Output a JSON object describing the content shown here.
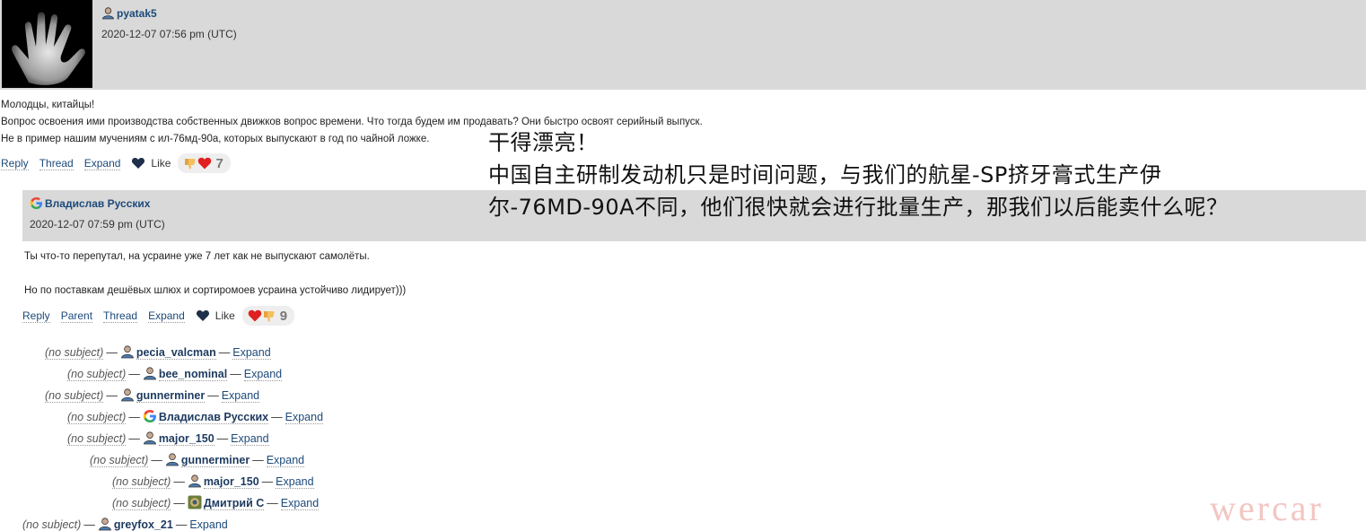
{
  "comment1": {
    "username": "pyatak5",
    "date": "2020-12-07 07:56 pm (UTC)",
    "body": [
      "Молодцы, китайцы!",
      "Вопрос освоения ими производства собственных движков вопрос времени. Что тогда будем им продавать? Они быстро освоят серийный выпуск.",
      "Не в пример нашим мучениям с ил-76мд-90а, которых выпускают в год по чайной ложке."
    ],
    "actions": {
      "reply": "Reply",
      "thread": "Thread",
      "expand": "Expand",
      "like": "Like",
      "reaction_count": "7"
    }
  },
  "comment2": {
    "username": "Владислав Русских",
    "date": "2020-12-07 07:59 pm (UTC)",
    "body": [
      "Ты что-то перепутал, на усраине уже 7 лет как не выпускают самолёты.",
      "Но по поставкам дешёвых шлюх и сортиромоев усраина устойчиво лидирует)))"
    ],
    "actions": {
      "reply": "Reply",
      "parent": "Parent",
      "thread": "Thread",
      "expand": "Expand",
      "like": "Like",
      "reaction_count": "9"
    }
  },
  "thread": [
    {
      "subject": "(no subject)",
      "author": "pecia_valcman",
      "expand": "Expand",
      "icon": "user-icon"
    },
    {
      "subject": "(no subject)",
      "author": "bee_nominal",
      "expand": "Expand",
      "icon": "user-icon"
    },
    {
      "subject": "(no subject)",
      "author": "gunnerminer",
      "expand": "Expand",
      "icon": "user-icon"
    },
    {
      "subject": "(no subject)",
      "author": "Владислав Русских",
      "expand": "Expand",
      "icon": "google-icon"
    },
    {
      "subject": "(no subject)",
      "author": "major_150",
      "expand": "Expand",
      "icon": "user-icon"
    },
    {
      "subject": "(no subject)",
      "author": "gunnerminer",
      "expand": "Expand",
      "icon": "user-icon"
    },
    {
      "subject": "(no subject)",
      "author": "major_150",
      "expand": "Expand",
      "icon": "user-icon"
    },
    {
      "subject": "(no subject)",
      "author": "Дмитрий С",
      "expand": "Expand",
      "icon": "photo-avatar-icon"
    },
    {
      "subject": "(no subject)",
      "author": "greyfox_21",
      "expand": "Expand",
      "icon": "user-icon"
    }
  ],
  "caption": [
    "干得漂亮！",
    "中国自主研制发动机只是时间问题，与我们的航星-SP挤牙膏式生产伊",
    "尔-76MD-90A不同，他们很快就会进行批量生产，那我们以后能卖什么呢？"
  ],
  "watermark": "wercar",
  "colors": {
    "header_bg": "#d9d9d9",
    "link": "#1d4a7a",
    "heart_red": "#e02020",
    "watermark": "#f2c6c3"
  }
}
